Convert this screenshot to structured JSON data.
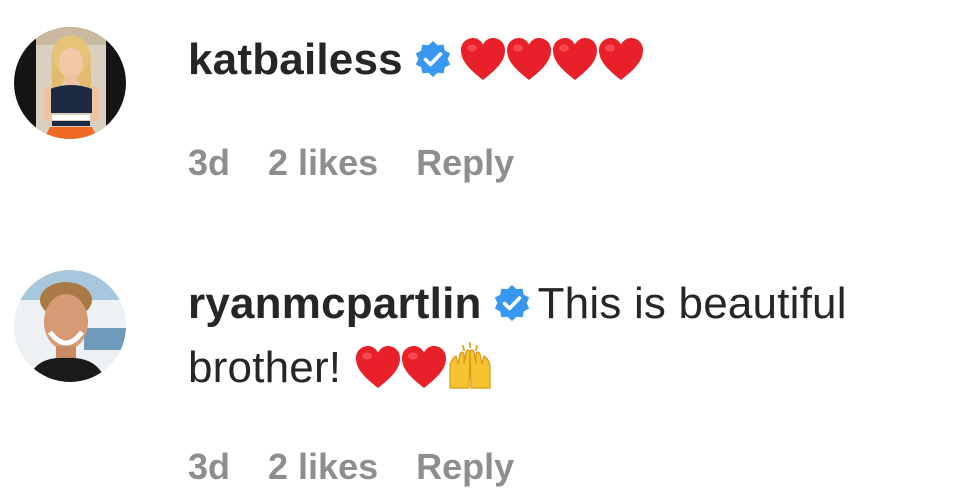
{
  "comments": [
    {
      "username": "katbailess",
      "verified": true,
      "text_line1": "",
      "text_line2": "",
      "emoji": [
        "red-heart",
        "red-heart",
        "red-heart",
        "red-heart"
      ],
      "time": "3d",
      "likes": "2 likes",
      "reply": "Reply"
    },
    {
      "username": "ryanmcpartlin",
      "verified": true,
      "text_line1": "This is beautiful",
      "text_line2": "brother!",
      "emoji": [
        "red-heart",
        "red-heart",
        "raising-hands"
      ],
      "time": "3d",
      "likes": "2 likes",
      "reply": "Reply"
    }
  ],
  "colors": {
    "text": "#262626",
    "meta": "#8e8e8e",
    "verified_badge": "#3897f0",
    "heart": "#e8202a",
    "raising_hands": "#f7c233"
  }
}
